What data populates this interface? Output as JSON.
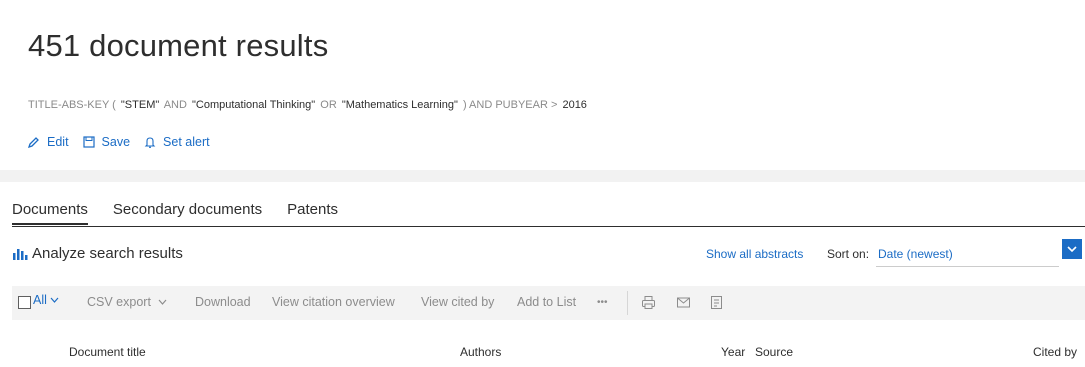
{
  "header": {
    "results_title": "451 document results"
  },
  "query": {
    "parts": [
      {
        "text": "TITLE-ABS-KEY (",
        "kind": "op"
      },
      {
        "text": "\"STEM\"",
        "kind": "val"
      },
      {
        "text": "AND",
        "kind": "op"
      },
      {
        "text": "\"Computational Thinking\"",
        "kind": "val"
      },
      {
        "text": "OR",
        "kind": "op"
      },
      {
        "text": "\"Mathematics Learning\"",
        "kind": "val"
      },
      {
        "text": ") AND PUBYEAR >",
        "kind": "op"
      },
      {
        "text": "2016",
        "kind": "val"
      }
    ]
  },
  "actions": {
    "edit": "Edit",
    "save": "Save",
    "set_alert": "Set alert"
  },
  "tabs": [
    {
      "label": "Documents",
      "active": true
    },
    {
      "label": "Secondary documents",
      "active": false
    },
    {
      "label": "Patents",
      "active": false
    }
  ],
  "analyze": {
    "label": "Analyze search results"
  },
  "sort": {
    "show_all_abstracts": "Show all abstracts",
    "label": "Sort on:",
    "value": "Date (newest)"
  },
  "toolbar": {
    "all": "All",
    "csv_export": "CSV export",
    "download": "Download",
    "view_citation_overview": "View citation overview",
    "view_cited_by": "View cited by",
    "add_to_list": "Add to List",
    "more": "•••"
  },
  "columns": {
    "document_title": "Document title",
    "authors": "Authors",
    "year": "Year",
    "source": "Source",
    "cited_by": "Cited by"
  },
  "colors": {
    "accent": "#1b6cc5",
    "text": "#2e2e2e",
    "muted": "#8c8c8c",
    "toolbar_bg": "#f3f3f3"
  },
  "icons": [
    "pencil-icon",
    "save-icon",
    "bell-icon",
    "bar-chart-icon",
    "chevron-down-icon",
    "print-icon",
    "email-icon",
    "export-icon"
  ]
}
